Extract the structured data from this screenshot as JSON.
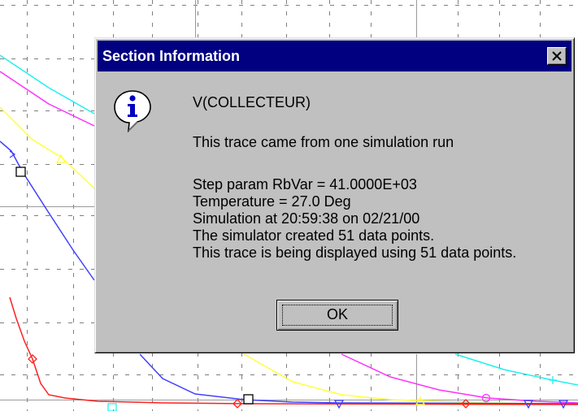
{
  "dialog": {
    "title": "Section Information",
    "trace_name": "V(COLLECTEUR)",
    "source_line": "This trace came from one simulation run",
    "details": [
      "Step param RbVar =   41.0000E+03",
      "Temperature =  27.0 Deg",
      "Simulation at 20:59:38 on 02/21/00",
      "The simulator created 51 data points.",
      "This trace is being displayed using 51 data points."
    ],
    "ok_label": "OK"
  },
  "icons": {
    "dialog": "info-icon",
    "close": "close-icon"
  },
  "colors": {
    "titlebar": "#000080",
    "dialog_face": "#c0c0c0",
    "grid": "#7f7f7f",
    "trace_red": "#ff2020",
    "trace_blue": "#4040ff",
    "trace_yellow": "#ffff40",
    "trace_magenta": "#ff30ff",
    "trace_cyan": "#20f0f0"
  }
}
